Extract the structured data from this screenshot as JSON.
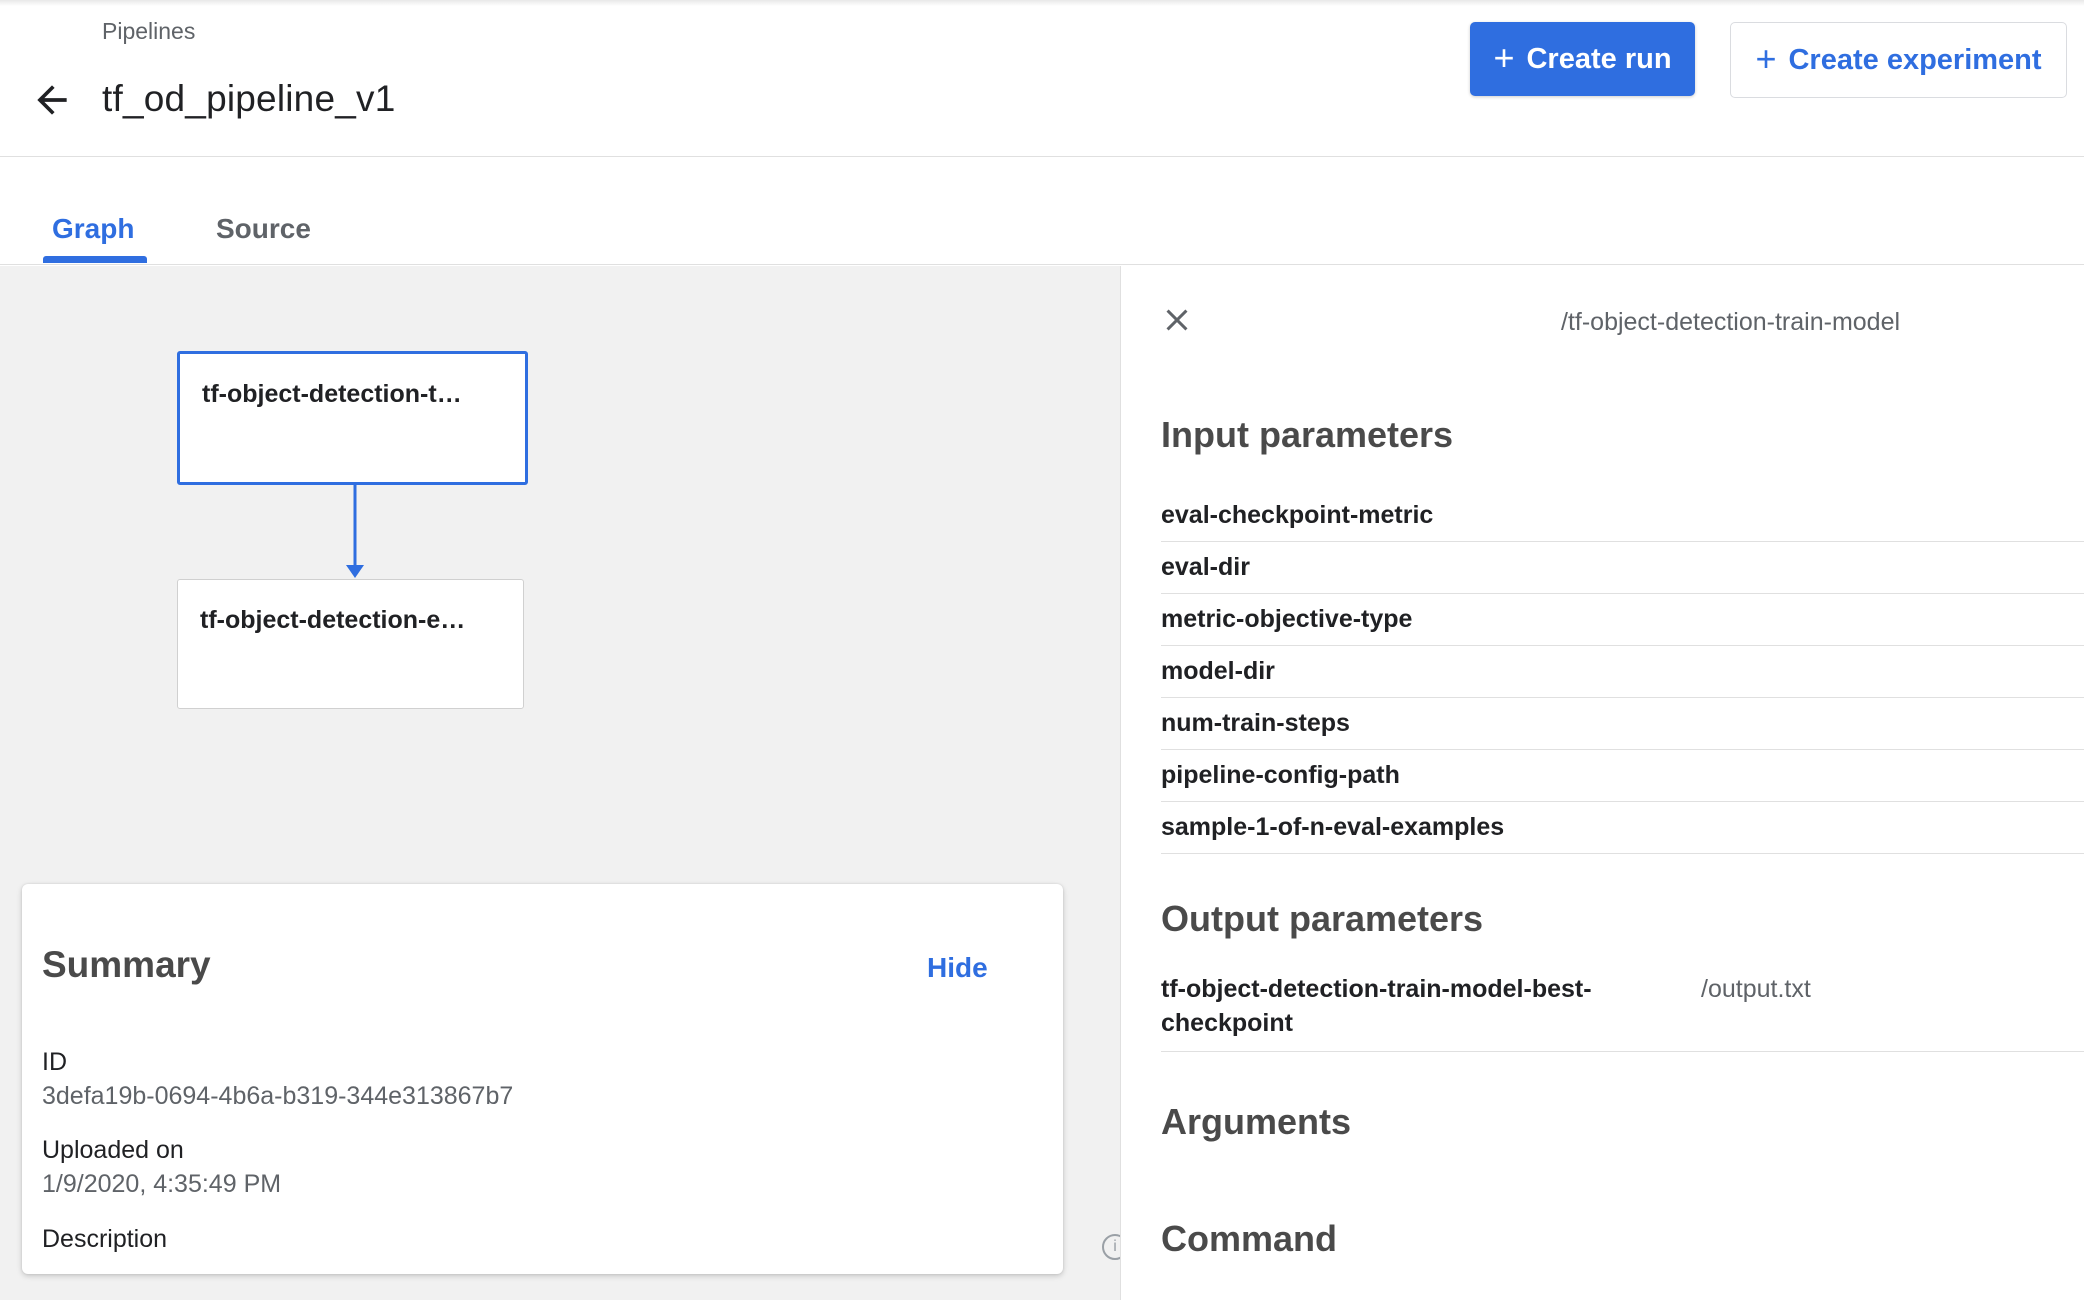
{
  "header": {
    "breadcrumb": "Pipelines",
    "title": "tf_od_pipeline_v1",
    "create_run_label": "Create run",
    "create_experiment_label": "Create experiment"
  },
  "tabs": [
    {
      "label": "Graph",
      "active": true
    },
    {
      "label": "Source",
      "active": false
    }
  ],
  "graph": {
    "nodes": [
      {
        "label": "tf-object-detection-t…",
        "selected": true
      },
      {
        "label": "tf-object-detection-e…",
        "selected": false
      }
    ]
  },
  "summary": {
    "title": "Summary",
    "hide_label": "Hide",
    "id_label": "ID",
    "id_value": "3defa19b-0694-4b6a-b319-344e313867b7",
    "uploaded_label": "Uploaded on",
    "uploaded_value": "1/9/2020, 4:35:49 PM",
    "description_label": "Description"
  },
  "side_panel": {
    "title": "/tf-object-detection-train-model",
    "input_title": "Input parameters",
    "inputs": [
      "eval-checkpoint-metric",
      "eval-dir",
      "metric-objective-type",
      "model-dir",
      "num-train-steps",
      "pipeline-config-path",
      "sample-1-of-n-eval-examples"
    ],
    "output_title": "Output parameters",
    "outputs": [
      {
        "name": "tf-object-detection-train-model-best-checkpoint",
        "value": "/output.txt"
      }
    ],
    "arguments_title": "Arguments",
    "command_title": "Command"
  },
  "colors": {
    "accent": "#2f6ee0",
    "canvas": "#f1f1f1"
  },
  "icons": [
    "arrow-back-icon",
    "plus-icon",
    "close-icon",
    "info-icon"
  ]
}
